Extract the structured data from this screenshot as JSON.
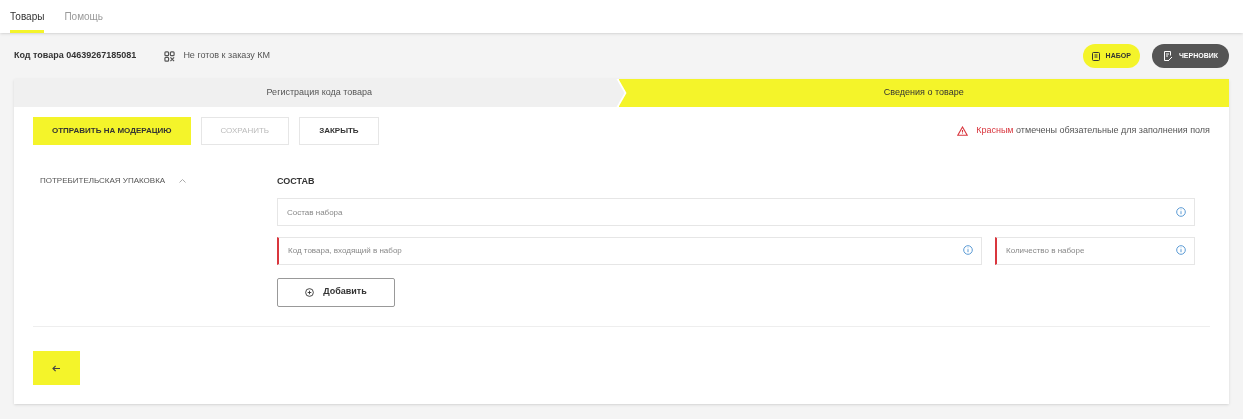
{
  "tabs": [
    {
      "label": "Товары",
      "selected": true
    },
    {
      "label": "Помощь",
      "selected": false
    }
  ],
  "header": {
    "product_code": "Код товара 04639267185081",
    "status": "Не готов к заказу КМ",
    "chips": [
      {
        "kind": "set",
        "label": "НАБОР"
      },
      {
        "kind": "draft",
        "label": "ЧЕРНОВИК"
      }
    ]
  },
  "steps": [
    {
      "label": "Регистрация кода товара",
      "selected": false
    },
    {
      "label": "Сведения о товаре",
      "selected": true
    }
  ],
  "actions": [
    {
      "kind": "primary",
      "label": "ОТПРАВИТЬ НА МОДЕРАЦИЮ",
      "disabled": false
    },
    {
      "kind": "secondary",
      "label": "СОХРАНИТЬ",
      "disabled": true
    },
    {
      "kind": "secondary",
      "label": "ЗАКРЫТЬ",
      "disabled": false
    }
  ],
  "required_note": {
    "highlight": "Красным",
    "text": "отмечены обязательные для заполнения поля"
  },
  "sidebar": {
    "items": [
      {
        "label": "ПОТРЕБИТЕЛЬСКАЯ УПАКОВКА",
        "expanded": true
      }
    ]
  },
  "section": {
    "title": "СОСТАВ",
    "rows": [
      {
        "fields": [
          {
            "placeholder": "Состав набора",
            "required": false
          }
        ]
      },
      {
        "fields": [
          {
            "placeholder": "Код товара, входящий в набор",
            "required": true
          },
          {
            "placeholder": "Количество в наборе",
            "required": true
          }
        ]
      }
    ],
    "add_button": "Добавить"
  }
}
